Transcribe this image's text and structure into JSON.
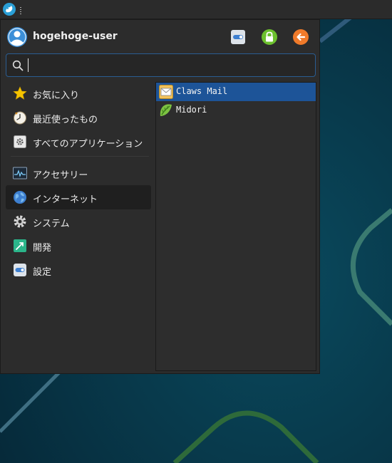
{
  "user": {
    "name": "hogehoge-user"
  },
  "search": {
    "value": "",
    "placeholder": ""
  },
  "categories": [
    {
      "label": "お気に入り",
      "icon": "star-icon"
    },
    {
      "label": "最近使ったもの",
      "icon": "clock-icon"
    },
    {
      "label": "すべてのアプリケーション",
      "icon": "applications-icon"
    },
    {
      "label": "アクセサリー",
      "icon": "system-monitor-icon"
    },
    {
      "label": "インターネット",
      "icon": "globe-icon",
      "active": true
    },
    {
      "label": "システム",
      "icon": "gear-icon"
    },
    {
      "label": "開発",
      "icon": "development-icon"
    },
    {
      "label": "設定",
      "icon": "settings-toggle-icon"
    }
  ],
  "apps": [
    {
      "label": "Claws Mail",
      "icon": "mail-icon",
      "selected": true
    },
    {
      "label": "Midori",
      "icon": "midori-icon"
    }
  ],
  "colors": {
    "accent": "#1d5498",
    "search_border": "#2a5d92",
    "menu_bg": "#2c2c2c",
    "desktop_bg": "#073a4c"
  }
}
